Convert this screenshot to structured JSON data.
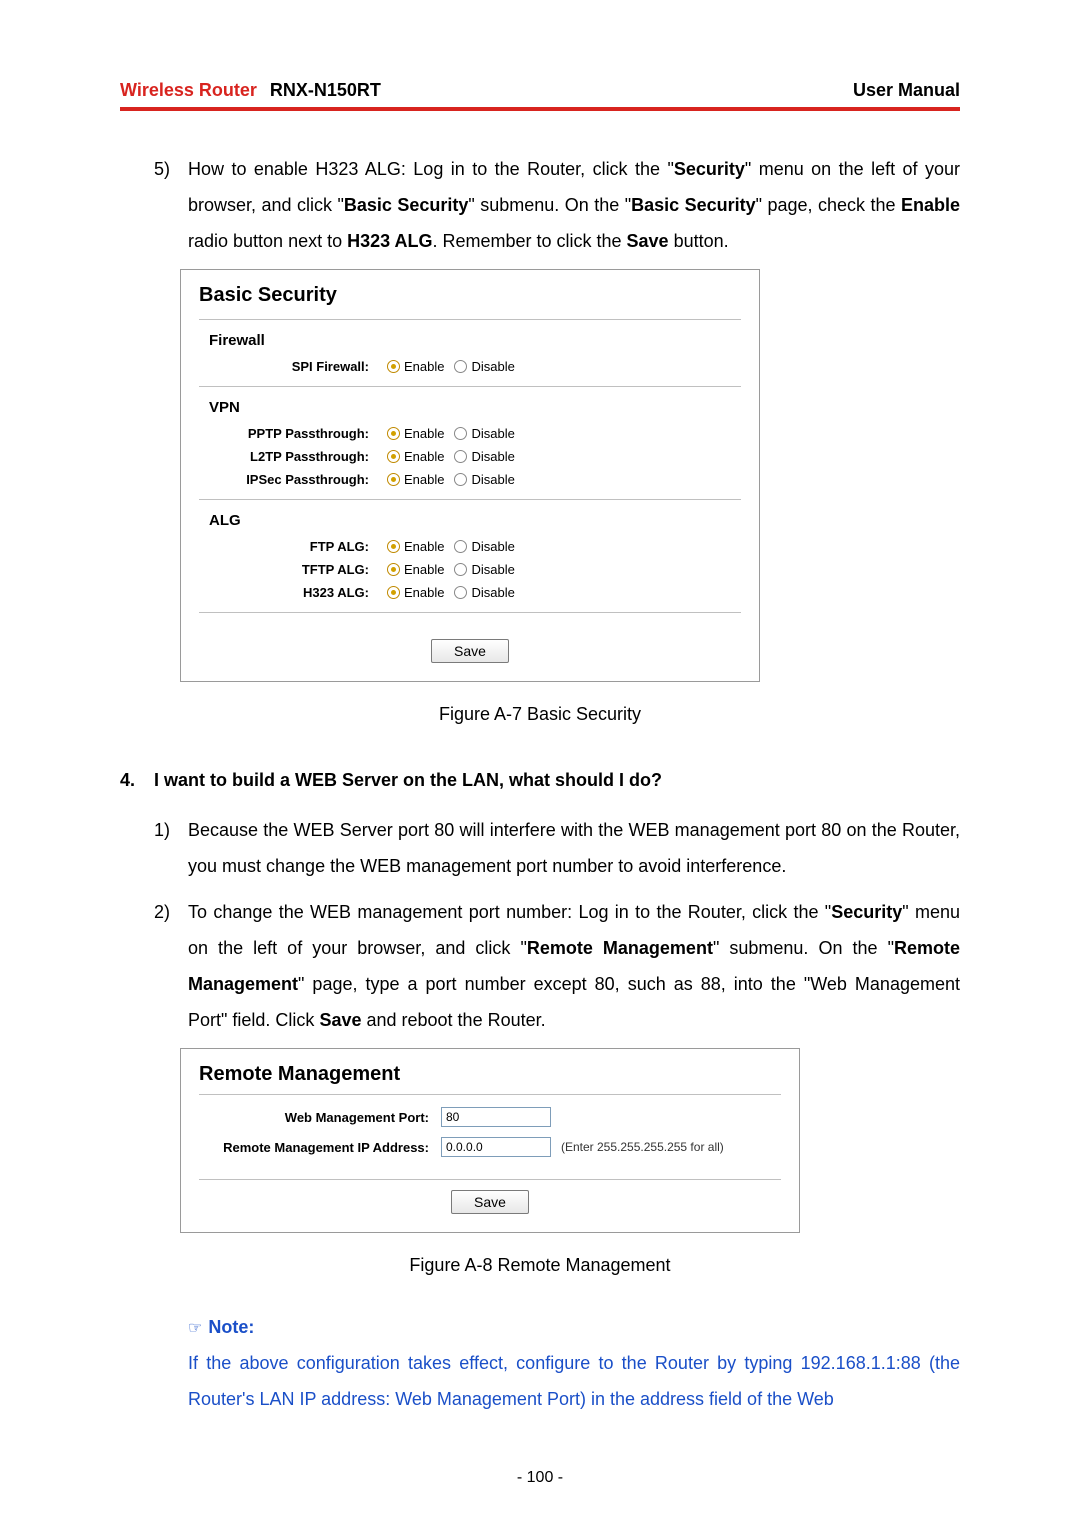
{
  "header": {
    "brand": "Wireless Router",
    "model": "RNX-N150RT",
    "right": "User Manual"
  },
  "para5": {
    "num": "5)",
    "t1": "How to enable H323 ALG: Log in to the Router, click the \"",
    "t2": "Security",
    "t3": "\" menu on the left of your browser, and click \"",
    "t4": "Basic Security",
    "t5": "\" submenu. On the \"",
    "t6": "Basic Security",
    "t7": "\" page, check the ",
    "t8": "Enable",
    "t9": " radio button next to ",
    "t10": "H323 ALG",
    "t11": ". Remember to click the ",
    "t12": "Save",
    "t13": " button."
  },
  "basicPanel": {
    "title": "Basic Security",
    "sections": {
      "firewall": {
        "title": "Firewall",
        "rows": {
          "spi": {
            "label": "SPI Firewall:",
            "enable": "Enable",
            "disable": "Disable"
          }
        }
      },
      "vpn": {
        "title": "VPN",
        "rows": {
          "pptp": {
            "label": "PPTP Passthrough:",
            "enable": "Enable",
            "disable": "Disable"
          },
          "l2tp": {
            "label": "L2TP Passthrough:",
            "enable": "Enable",
            "disable": "Disable"
          },
          "ipsec": {
            "label": "IPSec Passthrough:",
            "enable": "Enable",
            "disable": "Disable"
          }
        }
      },
      "alg": {
        "title": "ALG",
        "rows": {
          "ftp": {
            "label": "FTP ALG:",
            "enable": "Enable",
            "disable": "Disable"
          },
          "tftp": {
            "label": "TFTP ALG:",
            "enable": "Enable",
            "disable": "Disable"
          },
          "h323": {
            "label": "H323 ALG:",
            "enable": "Enable",
            "disable": "Disable"
          }
        }
      }
    },
    "save": "Save"
  },
  "figA7": "Figure A-7    Basic Security",
  "heading4": {
    "num": "4.",
    "text": "I want to build a WEB Server on the LAN, what should I do?"
  },
  "para1": {
    "num": "1)",
    "text": "Because the WEB Server port 80 will interfere with the WEB management port 80 on the Router, you must change the WEB management port number to avoid interference."
  },
  "para2": {
    "num": "2)",
    "t1": "To change the WEB management port number: Log in to the Router, click the \"",
    "t2": "Security",
    "t3": "\" menu on the left of your browser, and click \"",
    "t4": "Remote Management",
    "t5": "\" submenu. On the \"",
    "t6": "Remote Management",
    "t7": "\" page, type a port number except 80, such as 88, into the \"Web Management Port\" field. Click ",
    "t8": "Save",
    "t9": " and reboot the Router."
  },
  "remotePanel": {
    "title": "Remote Management",
    "portLabel": "Web Management Port:",
    "portValue": "80",
    "ipLabel": "Remote Management IP Address:",
    "ipValue": "0.0.0.0",
    "ipHint": "(Enter 255.255.255.255 for all)",
    "save": "Save"
  },
  "figA8": "Figure A-8    Remote Management",
  "note": {
    "label": "Note:",
    "text": "If the above configuration takes effect, configure to the Router by typing 192.168.1.1:88 (the Router's LAN IP address: Web Management Port) in the address field of the Web"
  },
  "pageNumber": "- 100 -"
}
